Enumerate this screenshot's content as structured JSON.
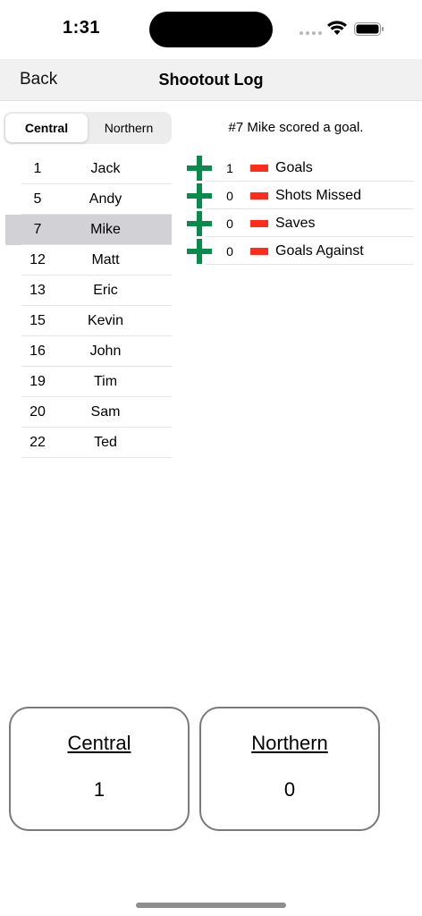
{
  "status": {
    "time": "1:31"
  },
  "nav": {
    "back_label": "Back",
    "title": "Shootout Log"
  },
  "segments": [
    {
      "label": "Central",
      "active": true
    },
    {
      "label": "Northern",
      "active": false
    }
  ],
  "players": [
    {
      "number": "1",
      "name": "Jack"
    },
    {
      "number": "5",
      "name": "Andy"
    },
    {
      "number": "7",
      "name": "Mike"
    },
    {
      "number": "12",
      "name": "Matt"
    },
    {
      "number": "13",
      "name": "Eric"
    },
    {
      "number": "15",
      "name": "Kevin"
    },
    {
      "number": "16",
      "name": "John"
    },
    {
      "number": "19",
      "name": "Tim"
    },
    {
      "number": "20",
      "name": "Sam"
    },
    {
      "number": "22",
      "name": "Ted"
    }
  ],
  "selected_player_index": 2,
  "event_message": "#7 Mike scored a goal.",
  "stats": [
    {
      "value": "1",
      "label": "Goals"
    },
    {
      "value": "0",
      "label": "Shots Missed"
    },
    {
      "value": "0",
      "label": "Saves"
    },
    {
      "value": "0",
      "label": "Goals Against"
    }
  ],
  "scores": {
    "central": {
      "team": "Central",
      "score": "1"
    },
    "northern": {
      "team": "Northern",
      "score": "0"
    }
  },
  "colors": {
    "plus": "#0a8a4c",
    "minus": "#ff2d1a",
    "selected_row": "#d1d1d6"
  }
}
